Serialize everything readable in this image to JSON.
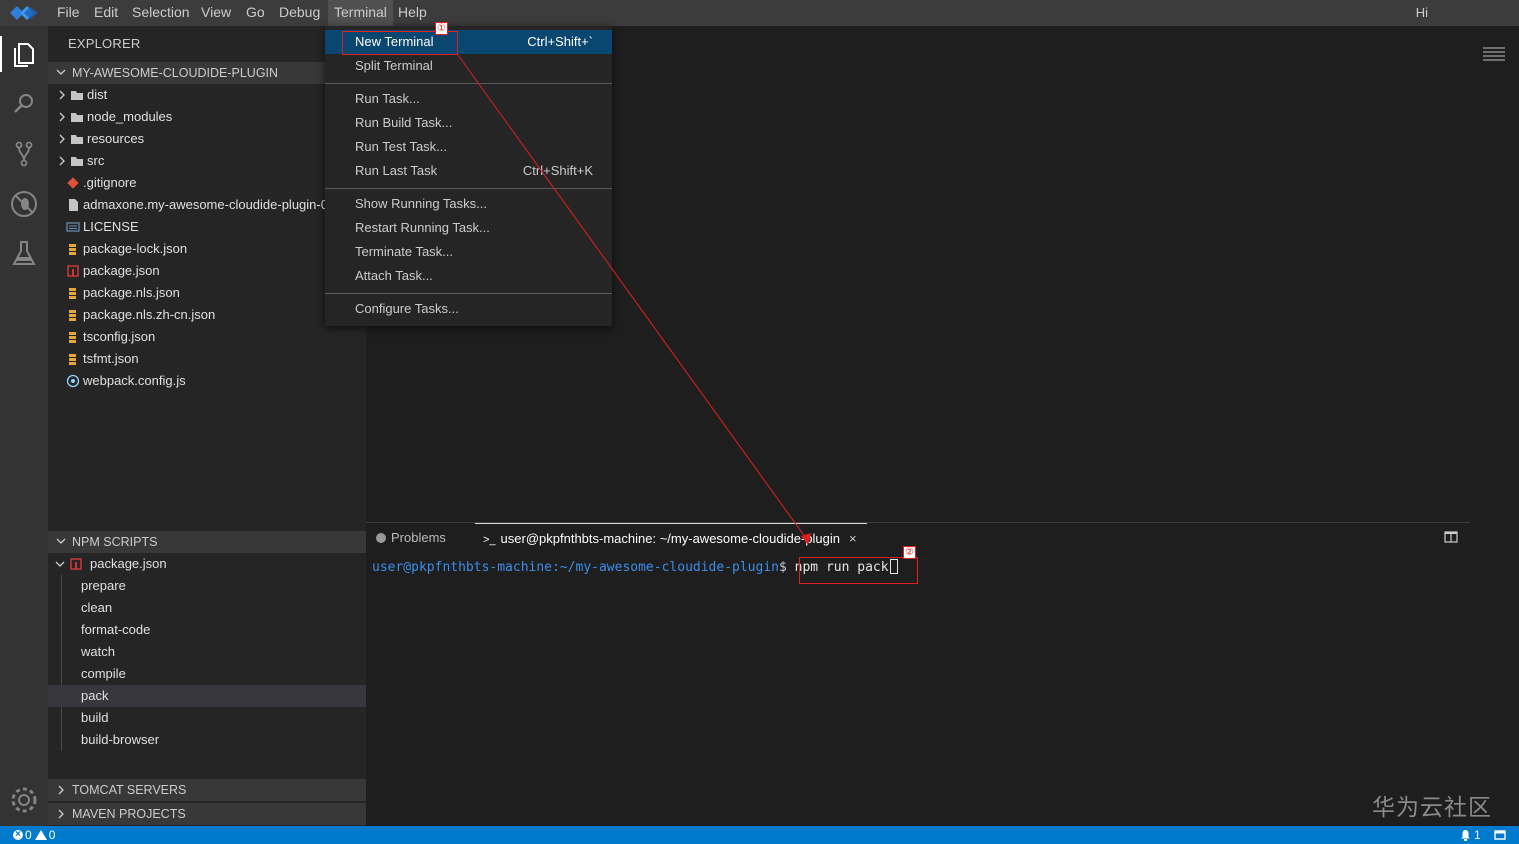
{
  "menubar": {
    "items": [
      "File",
      "Edit",
      "Selection",
      "View",
      "Go",
      "Debug",
      "Terminal",
      "Help"
    ],
    "active": "Terminal",
    "user_greeting": "Hi"
  },
  "sidebar": {
    "title": "EXPLORER",
    "project": "MY-AWESOME-CLOUDIDE-PLUGIN",
    "files": [
      {
        "label": "dist",
        "type": "folder"
      },
      {
        "label": "node_modules",
        "type": "folder"
      },
      {
        "label": "resources",
        "type": "folder"
      },
      {
        "label": "src",
        "type": "folder"
      },
      {
        "label": ".gitignore",
        "type": "git"
      },
      {
        "label": "admaxone.my-awesome-cloudide-plugin-0",
        "type": "file"
      },
      {
        "label": "LICENSE",
        "type": "license"
      },
      {
        "label": "package-lock.json",
        "type": "json"
      },
      {
        "label": "package.json",
        "type": "npm"
      },
      {
        "label": "package.nls.json",
        "type": "json"
      },
      {
        "label": "package.nls.zh-cn.json",
        "type": "json"
      },
      {
        "label": "tsconfig.json",
        "type": "json"
      },
      {
        "label": "tsfmt.json",
        "type": "json"
      },
      {
        "label": "webpack.config.js",
        "type": "webpack"
      }
    ],
    "npm_section": "NPM SCRIPTS",
    "npm_package": "package.json",
    "scripts": [
      "prepare",
      "clean",
      "format-code",
      "watch",
      "compile",
      "pack",
      "build",
      "build-browser"
    ],
    "selected_script": "pack",
    "tomcat": "TOMCAT SERVERS",
    "maven": "MAVEN PROJECTS"
  },
  "terminal_menu": {
    "groups": [
      [
        {
          "label": "New Terminal",
          "shortcut": "Ctrl+Shift+`",
          "hover": true
        },
        {
          "label": "Split Terminal",
          "shortcut": ""
        }
      ],
      [
        {
          "label": "Run Task...",
          "shortcut": ""
        },
        {
          "label": "Run Build Task...",
          "shortcut": ""
        },
        {
          "label": "Run Test Task...",
          "shortcut": ""
        },
        {
          "label": "Run Last Task",
          "shortcut": "Ctrl+Shift+K"
        }
      ],
      [
        {
          "label": "Show Running Tasks...",
          "shortcut": ""
        },
        {
          "label": "Restart Running Task...",
          "shortcut": ""
        },
        {
          "label": "Terminate Task...",
          "shortcut": ""
        },
        {
          "label": "Attach Task...",
          "shortcut": ""
        }
      ],
      [
        {
          "label": "Configure Tasks...",
          "shortcut": ""
        }
      ]
    ]
  },
  "panel": {
    "problems_tab": "Problems",
    "terminal_tab": "user@pkpfnthbts-machine: ~/my-awesome-cloudide-plugin",
    "prompt_user": "user@pkpfnthbts-machine",
    "prompt_path": ":~/my-awesome-cloudide-plugin",
    "prompt_symbol": "$",
    "command": "npm run pack"
  },
  "annotations": {
    "marker1": "①",
    "marker2": "②"
  },
  "statusbar": {
    "errors": "0",
    "warnings": "0",
    "notifications": "1"
  },
  "watermark": "华为云社区",
  "colors": {
    "accent": "#007acc",
    "menu_hover": "#094771",
    "annotation": "#e02020",
    "terminal_user": "#3b8eea"
  }
}
